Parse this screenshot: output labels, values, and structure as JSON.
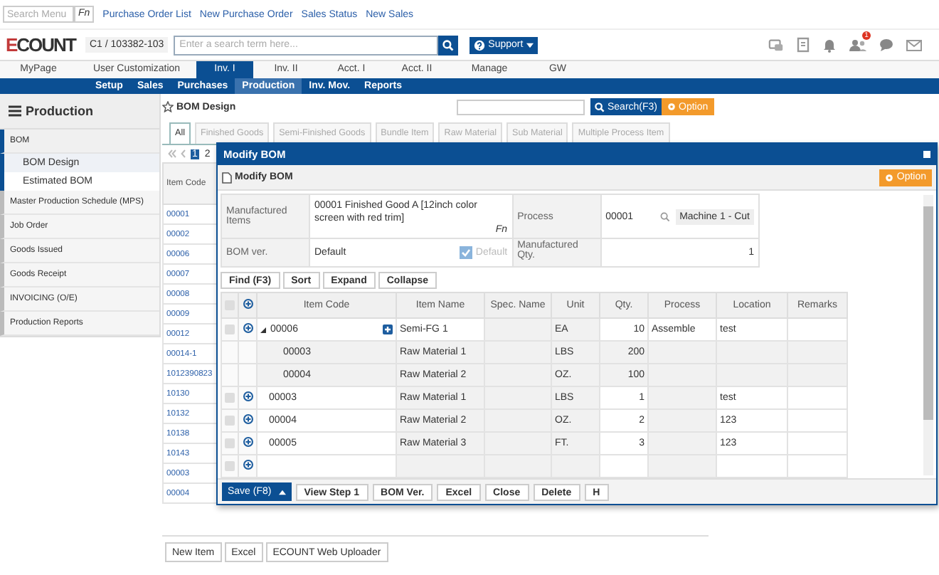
{
  "top_bar": {
    "search_menu": {
      "placeholder": "Search Menu"
    },
    "fn_label": "Fn",
    "links": [
      "Purchase Order List",
      "New Purchase Order",
      "Sales Status",
      "New Sales"
    ]
  },
  "header": {
    "logo": "ECOUNT",
    "company": "C1 / 103382-103",
    "search": {
      "placeholder": "Enter a search term here..."
    },
    "support": "Support",
    "notification_badge": "1"
  },
  "main_menu": [
    {
      "label": "MyPage",
      "selected": false
    },
    {
      "label": "User Customization",
      "selected": false
    },
    {
      "label": "Inv. I",
      "selected": true
    },
    {
      "label": "Inv. II",
      "selected": false
    },
    {
      "label": "Acct. I",
      "selected": false
    },
    {
      "label": "Acct. II",
      "selected": false
    },
    {
      "label": "Manage",
      "selected": false
    },
    {
      "label": "GW",
      "selected": false
    }
  ],
  "sub_menu": [
    {
      "label": "Setup",
      "selected": false
    },
    {
      "label": "Sales",
      "selected": false
    },
    {
      "label": "Purchases",
      "selected": false
    },
    {
      "label": "Production",
      "selected": true
    },
    {
      "label": "Inv. Mov.",
      "selected": false
    },
    {
      "label": "Reports",
      "selected": false
    }
  ],
  "sidebar": {
    "title": "Production",
    "items": [
      {
        "label": "BOM",
        "expanded": true,
        "children": [
          {
            "label": "BOM Design",
            "selected": true
          },
          {
            "label": "Estimated BOM",
            "selected": false
          }
        ]
      },
      {
        "label": "Master Production Schedule (MPS)",
        "expanded": false
      },
      {
        "label": "Job Order",
        "expanded": false
      },
      {
        "label": "Goods Issued",
        "expanded": false
      },
      {
        "label": "Goods Receipt",
        "expanded": false
      },
      {
        "label": "INVOICING (O/E)",
        "expanded": false
      },
      {
        "label": "Production Reports",
        "expanded": false
      }
    ]
  },
  "content": {
    "title": "BOM Design",
    "search_button": "Search(F3)",
    "option_button": "Option",
    "tabs": [
      {
        "label": "All",
        "selected": true
      },
      {
        "label": "Finished Goods",
        "selected": false
      },
      {
        "label": "Semi-Finished Goods",
        "selected": false
      },
      {
        "label": "Bundle Item",
        "selected": false
      },
      {
        "label": "Raw Material",
        "selected": false
      },
      {
        "label": "Sub Material",
        "selected": false
      },
      {
        "label": "Multiple Process Item",
        "selected": false
      }
    ],
    "pages": [
      {
        "label": "1",
        "selected": true
      },
      {
        "label": "2",
        "selected": false
      }
    ],
    "list": {
      "column": "Item Code",
      "rows": [
        "00001",
        "00002",
        "00006",
        "00007",
        "00008",
        "00009",
        "00012",
        "00014-1",
        "1012390823",
        "10130",
        "10132",
        "10138",
        "10143",
        "00003",
        "00004"
      ]
    },
    "buttons": [
      "New Item",
      "Excel",
      "ECOUNT Web Uploader"
    ]
  },
  "modal": {
    "title": "Modify BOM",
    "toolbar_title": "Modify BOM",
    "option_button": "Option",
    "form": {
      "manufactured_items": {
        "label": "Manufactured Items",
        "value": "00001 Finished Good A [12inch color screen with red trim]",
        "fn_label": "Fn"
      },
      "process": {
        "label": "Process",
        "code": "00001",
        "name": "Machine 1 - Cut"
      },
      "bom_ver": {
        "label": "BOM ver.",
        "value": "Default",
        "default_checkbox": {
          "label": "Default",
          "checked": true,
          "disabled": true
        }
      },
      "manufactured_qty": {
        "label": "Manufactured Qty.",
        "value": "1"
      }
    },
    "grid_buttons": [
      "Find (F3)",
      "Sort",
      "Expand",
      "Collapse"
    ],
    "select_all_checked": false,
    "columns": [
      "Item Code",
      "Item Name",
      "Spec. Name",
      "Unit",
      "Qty.",
      "Process",
      "Location",
      "Remarks"
    ],
    "rows": [
      {
        "kind": "parent",
        "checked": false,
        "expanded": true,
        "item_code": "00006",
        "item_name": "Semi-FG 1",
        "unit": "EA",
        "qty": "10",
        "process": "Assemble",
        "location": "test"
      },
      {
        "kind": "child",
        "item_code": "00003",
        "item_name": "Raw Material 1",
        "unit": "LBS",
        "qty": "200"
      },
      {
        "kind": "child",
        "item_code": "00004",
        "item_name": "Raw Material 2",
        "unit": "OZ.",
        "qty": "100"
      },
      {
        "kind": "item",
        "checked": false,
        "item_code": "00003",
        "item_name": "Raw Material 1",
        "unit": "LBS",
        "qty": "1",
        "location": "test"
      },
      {
        "kind": "item",
        "checked": false,
        "item_code": "00004",
        "item_name": "Raw Material 2",
        "unit": "OZ.",
        "qty": "2",
        "location": "123"
      },
      {
        "kind": "item",
        "checked": false,
        "item_code": "00005",
        "item_name": "Raw Material 3",
        "unit": "FT.",
        "qty": "3",
        "location": "123"
      },
      {
        "kind": "empty",
        "checked": false
      }
    ],
    "footer_buttons": [
      {
        "label": "Save (F8)",
        "kind": "primary"
      },
      {
        "label": "View Step 1",
        "kind": "plain"
      },
      {
        "label": "BOM Ver.",
        "kind": "plain"
      },
      {
        "label": "Excel",
        "kind": "plain"
      },
      {
        "label": "Close",
        "kind": "plain"
      },
      {
        "label": "Delete",
        "kind": "plain"
      },
      {
        "label": "H",
        "kind": "plain"
      }
    ]
  }
}
